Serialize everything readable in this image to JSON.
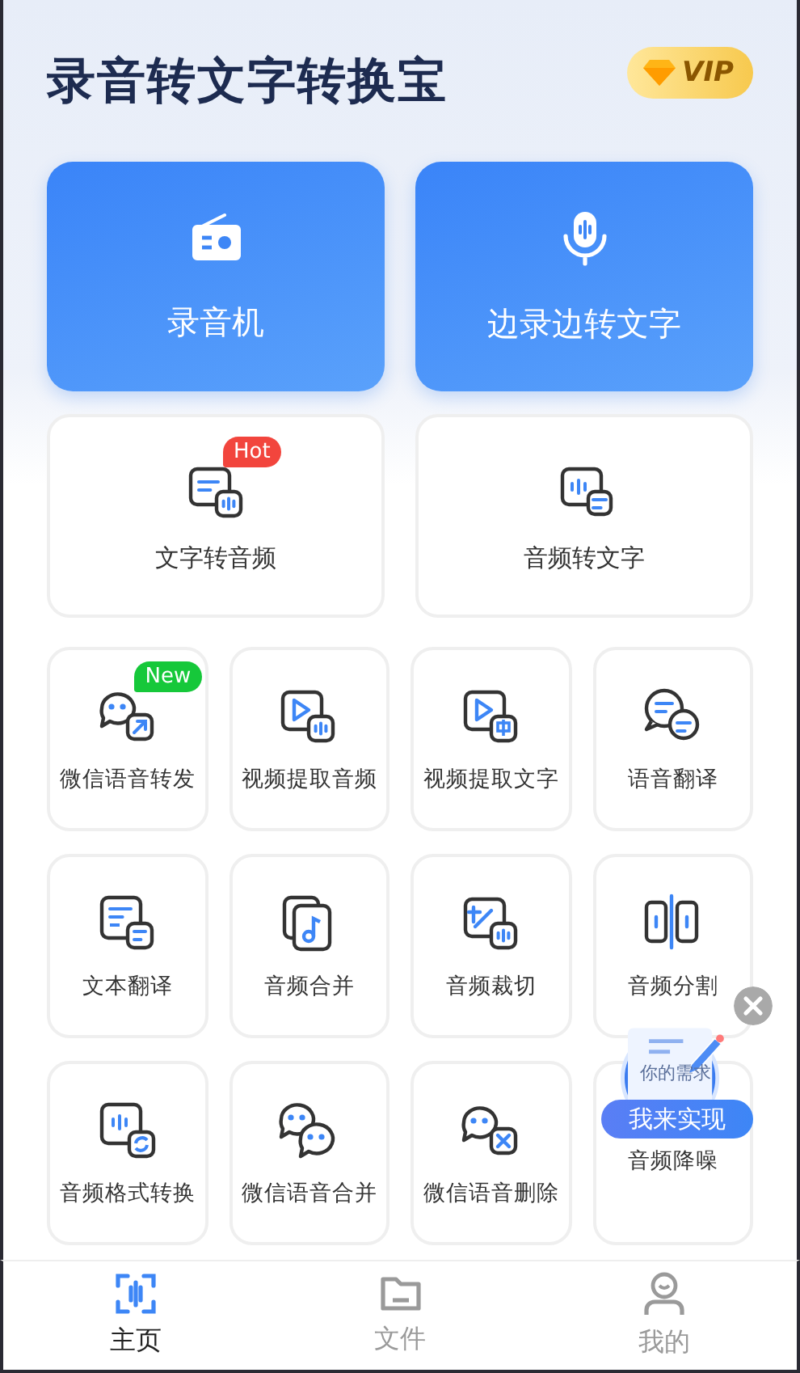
{
  "app_title": "录音转文字转换宝",
  "vip_badge": "VIP",
  "primary_actions": [
    {
      "label": "录音机",
      "kind": "radio"
    },
    {
      "label": "边录边转文字",
      "kind": "mic"
    }
  ],
  "feature_cards": [
    {
      "label": "文字转音频",
      "kind": "text-to-audio",
      "badge": {
        "text": "Hot",
        "color": "#f2453d"
      }
    },
    {
      "label": "音频转文字",
      "kind": "audio-to-text"
    }
  ],
  "tools": [
    {
      "label": "微信语音转发",
      "kind": "wechat-forward",
      "badge": {
        "text": "New",
        "color": "#16c83a"
      }
    },
    {
      "label": "视频提取音频",
      "kind": "video-audio"
    },
    {
      "label": "视频提取文字",
      "kind": "video-text"
    },
    {
      "label": "语音翻译",
      "kind": "translate-voice"
    },
    {
      "label": "文本翻译",
      "kind": "text-translate"
    },
    {
      "label": "音频合并",
      "kind": "audio-merge"
    },
    {
      "label": "音频裁切",
      "kind": "audio-cut"
    },
    {
      "label": "音频分割",
      "kind": "audio-split"
    },
    {
      "label": "音频格式转换",
      "kind": "format-convert"
    },
    {
      "label": "微信语音合并",
      "kind": "wechat-merge"
    },
    {
      "label": "微信语音删除",
      "kind": "wechat-delete"
    },
    {
      "label": "音频降噪"
    }
  ],
  "floating_promo": {
    "caption": "你的需求",
    "button": "我来实现"
  },
  "tab_bar": [
    {
      "label": "主页",
      "kind": "home",
      "selected": true
    },
    {
      "label": "文件",
      "kind": "files",
      "selected": false
    },
    {
      "label": "我的",
      "kind": "profile",
      "selected": false
    }
  ]
}
